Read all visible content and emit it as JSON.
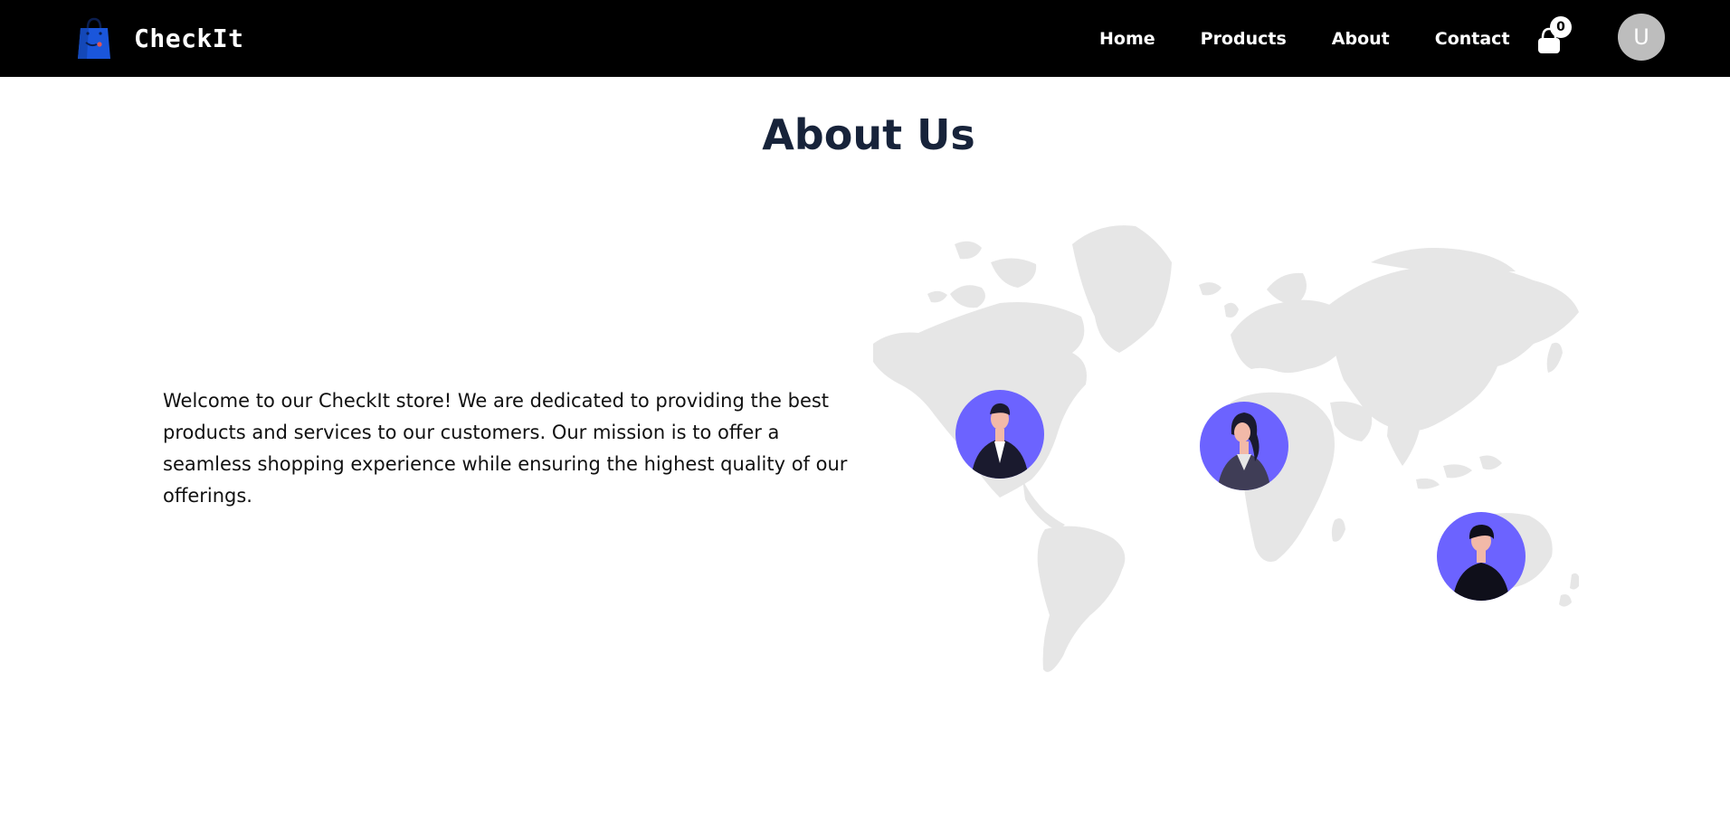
{
  "header": {
    "brand_name": "CheckIt",
    "brand_logo_icon": "shopping-bag-icon",
    "nav": [
      {
        "label": "Home"
      },
      {
        "label": "Products"
      },
      {
        "label": "About"
      },
      {
        "label": "Contact"
      }
    ],
    "cart": {
      "icon": "shopping-bag-icon",
      "count": "0"
    },
    "user_avatar": {
      "initial": "U"
    }
  },
  "main": {
    "title": "About Us",
    "description": "Welcome to our CheckIt store! We are dedicated to providing the best products and services to our customers. Our mission is to offer a seamless shopping experience while ensuring the highest quality of our offerings.",
    "illustration": {
      "icon": "world-map-icon",
      "people_icons": [
        "businessman-icon",
        "businesswoman-icon",
        "person-icon"
      ]
    }
  },
  "colors": {
    "nav_bg": "#000000",
    "title": "#17233a",
    "accent": "#6c63ff",
    "map": "#e6e6e6",
    "avatar_bg": "#bdbdbd",
    "logo": "#1a56db"
  }
}
